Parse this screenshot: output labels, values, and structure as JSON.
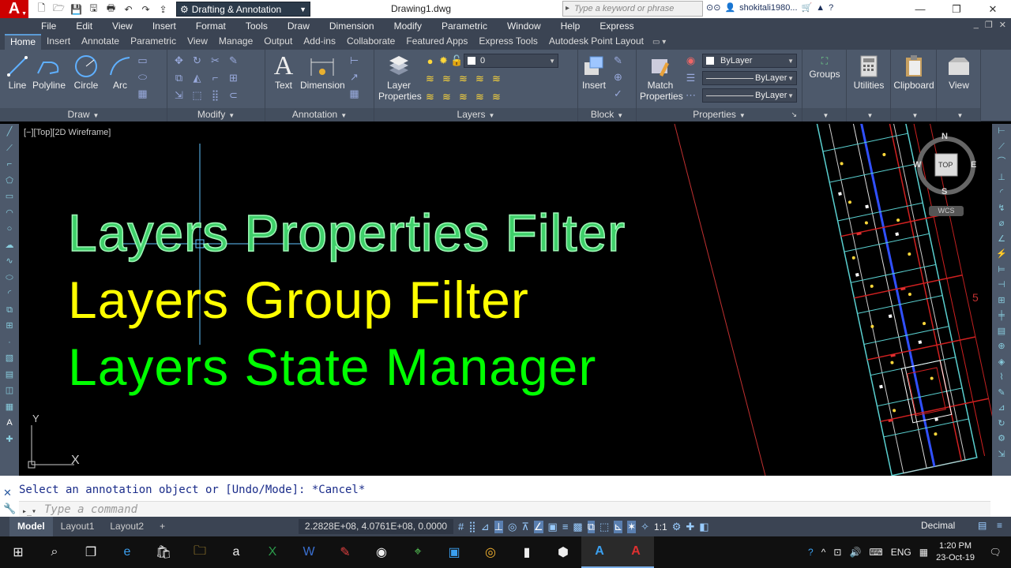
{
  "app": {
    "logo": "A",
    "workspace": "Drafting & Annotation",
    "doc_title": "Drawing1.dwg",
    "search_placeholder": "Type a keyword or phrase",
    "user": "shokitali1980..."
  },
  "menus": [
    "File",
    "Edit",
    "View",
    "Insert",
    "Format",
    "Tools",
    "Draw",
    "Dimension",
    "Modify",
    "Parametric",
    "Window",
    "Help",
    "Express"
  ],
  "tabs": [
    "Home",
    "Insert",
    "Annotate",
    "Parametric",
    "View",
    "Manage",
    "Output",
    "Add-ins",
    "Collaborate",
    "Featured Apps",
    "Express Tools",
    "Autodesk Point Layout"
  ],
  "ribbon": {
    "draw": {
      "title": "Draw",
      "tools": [
        "Line",
        "Polyline",
        "Circle",
        "Arc"
      ]
    },
    "modify": {
      "title": "Modify"
    },
    "annotation": {
      "title": "Annotation",
      "tools": [
        "Text",
        "Dimension"
      ]
    },
    "layers": {
      "title": "Layers",
      "tool_line1": "Layer",
      "tool_line2": "Properties",
      "current_layer": "0"
    },
    "block": {
      "title": "Block",
      "tool": "Insert"
    },
    "properties": {
      "title": "Properties",
      "match_line1": "Match",
      "match_line2": "Properties",
      "color": "ByLayer",
      "linetype": "ByLayer",
      "lineweight": "ByLayer"
    },
    "groups": {
      "label": "Groups"
    },
    "utilities": {
      "label": "Utilities"
    },
    "clipboard": {
      "label": "Clipboard"
    },
    "view": {
      "label": "View"
    }
  },
  "viewport": {
    "label": "[−][Top][2D Wireframe]",
    "line1": "Layers Properties Filter",
    "line2": "Layers Group Filter",
    "line3": "Layers State Manager",
    "ucs_y": "Y",
    "ucs_x": "X",
    "compass": {
      "n": "N",
      "s": "S",
      "e": "E",
      "w": "W",
      "top": "TOP",
      "wcs": "WCS"
    },
    "label_5": "5"
  },
  "command": {
    "history": "Select an annotation object or [Undo/Mode]: *Cancel*",
    "placeholder": "Type a command"
  },
  "status": {
    "layouts": [
      "Model",
      "Layout1",
      "Layout2"
    ],
    "coords": "2.2828E+08, 4.0761E+08, 0.0000",
    "scale": "1:1",
    "units": "Decimal"
  },
  "taskbar": {
    "lang": "ENG",
    "time": "1:20 PM",
    "date": "23-Oct-19"
  },
  "colors": {
    "accent_red": "#cc0000",
    "text_green1": "#3fd06a",
    "text_yellow": "#ffff00",
    "text_green2": "#00ff00",
    "ribbon_bg": "#4d596b"
  }
}
